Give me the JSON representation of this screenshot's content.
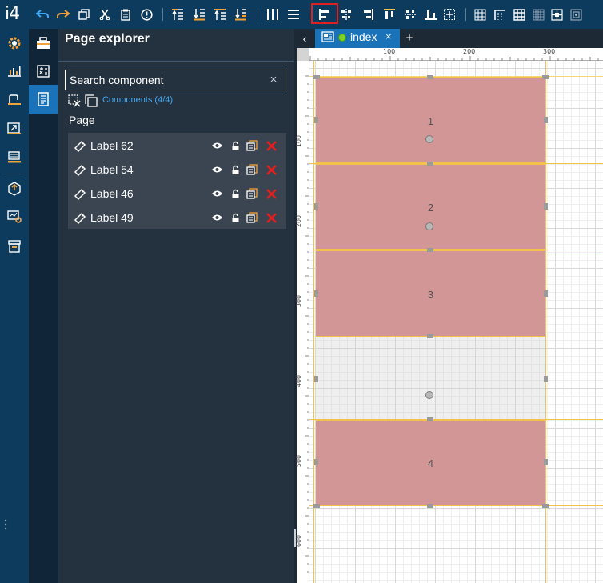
{
  "app": {
    "logo": "i4"
  },
  "colors": {
    "toolbar": "#0d3b5e",
    "accent": "#1a73b8",
    "component_fill": "#d29696",
    "delete": "#e02020",
    "guide": "#f2c24c"
  },
  "toolbar": {
    "icons": [
      "undo-icon",
      "redo-icon",
      "copy-icon",
      "cut-icon",
      "paste-icon",
      "alert-icon",
      "bring-front-icon",
      "send-back-icon",
      "bring-forward-icon",
      "send-backward-icon",
      "distribute-h-icon",
      "distribute-v-icon",
      "align-left-icon",
      "align-center-h-icon",
      "align-right-icon",
      "align-top-icon",
      "align-center-v-icon",
      "align-bottom-icon",
      "align-center-icon",
      "grid-icon",
      "grid-corner-icon",
      "grid-small-icon",
      "grid-dense-icon",
      "grid-select-icon",
      "grid-snap-icon"
    ]
  },
  "explorer": {
    "title": "Page explorer",
    "search_placeholder": "Search component",
    "search_clear": "×",
    "components_count": "Components (4/4)",
    "page_label": "Page",
    "items": [
      {
        "label": "Label 62"
      },
      {
        "label": "Label 54"
      },
      {
        "label": "Label 46"
      },
      {
        "label": "Label 49"
      }
    ]
  },
  "tabs": {
    "back": "‹",
    "active_label": "index",
    "close": "×",
    "add": "+"
  },
  "ruler": {
    "top_ticks": [
      "100",
      "200",
      "300"
    ],
    "left_ticks": [
      "100",
      "200",
      "300",
      "400",
      "500",
      "600"
    ]
  },
  "canvas": {
    "components": [
      {
        "number": "1"
      },
      {
        "number": "2"
      },
      {
        "number": "3"
      },
      {
        "number": ""
      },
      {
        "number": "4"
      }
    ]
  }
}
